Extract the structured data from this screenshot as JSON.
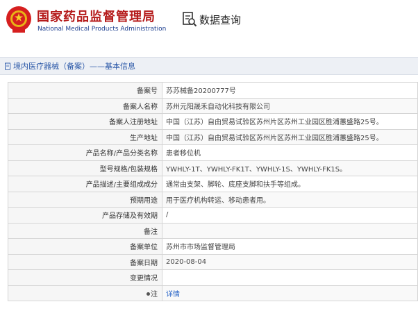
{
  "header": {
    "org_name_cn": "国家药品监督管理局",
    "org_name_en": "National Medical Products Administration",
    "query_title": "数据查询"
  },
  "breadcrumb": {
    "text": "境内医疗器械（备案）——基本信息"
  },
  "colors": {
    "brand_red": "#b51b1b",
    "brand_blue": "#1d3f8f",
    "link_blue": "#2b66c8",
    "breadcrumb_bg": "#edf0f5"
  },
  "rows": [
    {
      "label": "备案号",
      "value": "苏苏械备20200777号"
    },
    {
      "label": "备案人名称",
      "value": "苏州元阳晟禾自动化科技有限公司"
    },
    {
      "label": "备案人注册地址",
      "value": "中国（江苏）自由贸易试验区苏州片区苏州工业园区胜浦蕙盛路25号。"
    },
    {
      "label": "生产地址",
      "value": "中国（江苏）自由贸易试验区苏州片区苏州工业园区胜浦蕙盛路25号。"
    },
    {
      "label": "产品名称/产品分类名称",
      "value": "患者移位机"
    },
    {
      "label": "型号规格/包装规格",
      "value": "YWHLY-1T、YWHLY-FK1T、YWHLY-1S、YWHLY-FK1S。"
    },
    {
      "label": "产品描述/主要组成成分",
      "value": "通常由支架、脚轮、底座支脚和扶手等组成。"
    },
    {
      "label": "预期用途",
      "value": "用于医疗机构转运、移动患者用。"
    },
    {
      "label": "产品存储及有效期",
      "value": "/"
    },
    {
      "label": "备注",
      "value": ""
    },
    {
      "label": "备案单位",
      "value": "苏州市市场监督管理局"
    },
    {
      "label": "备案日期",
      "value": "2020-08-04"
    },
    {
      "label": "变更情况",
      "value": ""
    },
    {
      "label": "注",
      "value": "详情"
    }
  ]
}
